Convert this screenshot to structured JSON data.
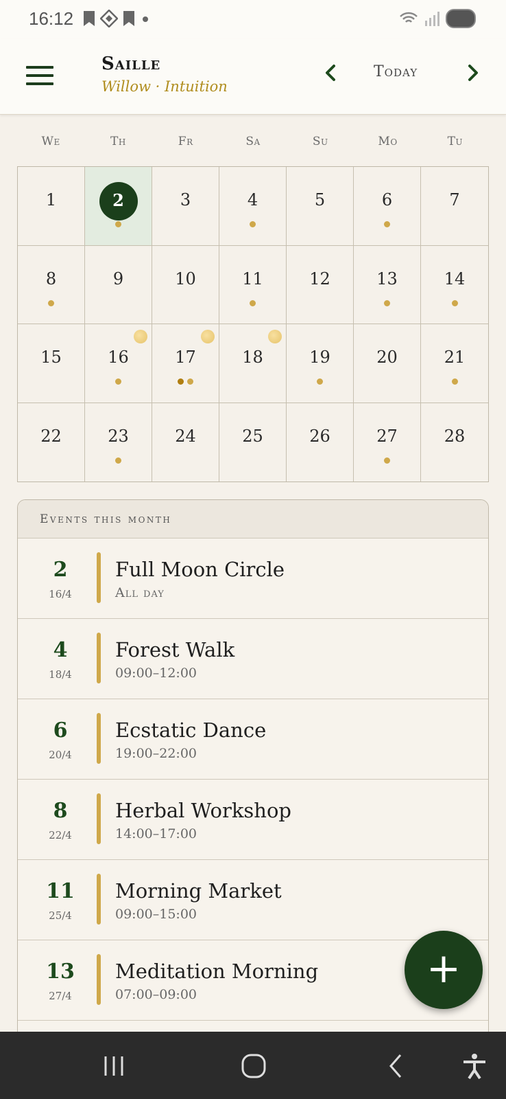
{
  "status_bar": {
    "time": "16:12"
  },
  "header": {
    "title": "Saille",
    "subtitle": "Willow · Intuition",
    "today_label": "Today"
  },
  "calendar": {
    "weekdays": [
      "We",
      "Th",
      "Fr",
      "Sa",
      "Su",
      "Mo",
      "Tu"
    ],
    "days": [
      {
        "n": "1",
        "dots": 0
      },
      {
        "n": "2",
        "dots": 1,
        "today": true
      },
      {
        "n": "3",
        "dots": 0
      },
      {
        "n": "4",
        "dots": 1
      },
      {
        "n": "5",
        "dots": 0
      },
      {
        "n": "6",
        "dots": 1
      },
      {
        "n": "7",
        "dots": 0
      },
      {
        "n": "8",
        "dots": 1
      },
      {
        "n": "9",
        "dots": 0
      },
      {
        "n": "10",
        "dots": 0
      },
      {
        "n": "11",
        "dots": 1
      },
      {
        "n": "12",
        "dots": 0
      },
      {
        "n": "13",
        "dots": 1
      },
      {
        "n": "14",
        "dots": 1
      },
      {
        "n": "15",
        "dots": 0
      },
      {
        "n": "16",
        "dots": 1,
        "moon": true
      },
      {
        "n": "17",
        "dots": 2,
        "moon": true
      },
      {
        "n": "18",
        "dots": 0,
        "moon": true
      },
      {
        "n": "19",
        "dots": 1
      },
      {
        "n": "20",
        "dots": 0
      },
      {
        "n": "21",
        "dots": 1
      },
      {
        "n": "22",
        "dots": 0
      },
      {
        "n": "23",
        "dots": 1
      },
      {
        "n": "24",
        "dots": 0
      },
      {
        "n": "25",
        "dots": 0
      },
      {
        "n": "26",
        "dots": 0
      },
      {
        "n": "27",
        "dots": 1
      },
      {
        "n": "28",
        "dots": 0
      }
    ]
  },
  "events": {
    "title": "Events this month",
    "items": [
      {
        "day": "2",
        "date": "16/4",
        "name": "Full Moon Circle",
        "time": "All day"
      },
      {
        "day": "4",
        "date": "18/4",
        "name": "Forest Walk",
        "time": "09:00–12:00"
      },
      {
        "day": "6",
        "date": "20/4",
        "name": "Ecstatic Dance",
        "time": "19:00–22:00"
      },
      {
        "day": "8",
        "date": "22/4",
        "name": "Herbal Workshop",
        "time": "14:00–17:00"
      },
      {
        "day": "11",
        "date": "25/4",
        "name": "Morning Market",
        "time": "09:00–15:00"
      },
      {
        "day": "13",
        "date": "27/4",
        "name": "Meditation Morning",
        "time": "07:00–09:00"
      }
    ]
  },
  "fab": {
    "label": "+"
  },
  "colors": {
    "accent": "#1b3f1b",
    "gold": "#cfa84a",
    "today_bg": "#e3ece0"
  }
}
